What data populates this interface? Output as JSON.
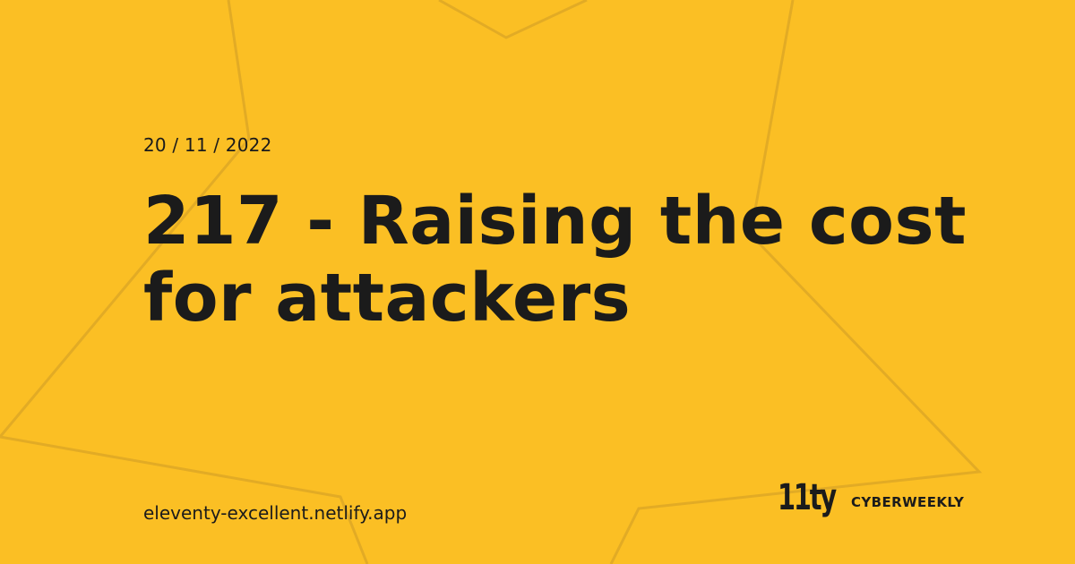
{
  "colors": {
    "background": "#FBBF24",
    "text": "#1B1B1B",
    "decoration_stroke": "#E2AB25"
  },
  "post": {
    "date": "20 / 11 / 2022",
    "title": "217 - Raising the cost for attackers"
  },
  "footer": {
    "site_url": "eleventy-excellent.netlify.app",
    "logo_text": "11ty",
    "brand_name": "CYBERWEEKLY"
  }
}
